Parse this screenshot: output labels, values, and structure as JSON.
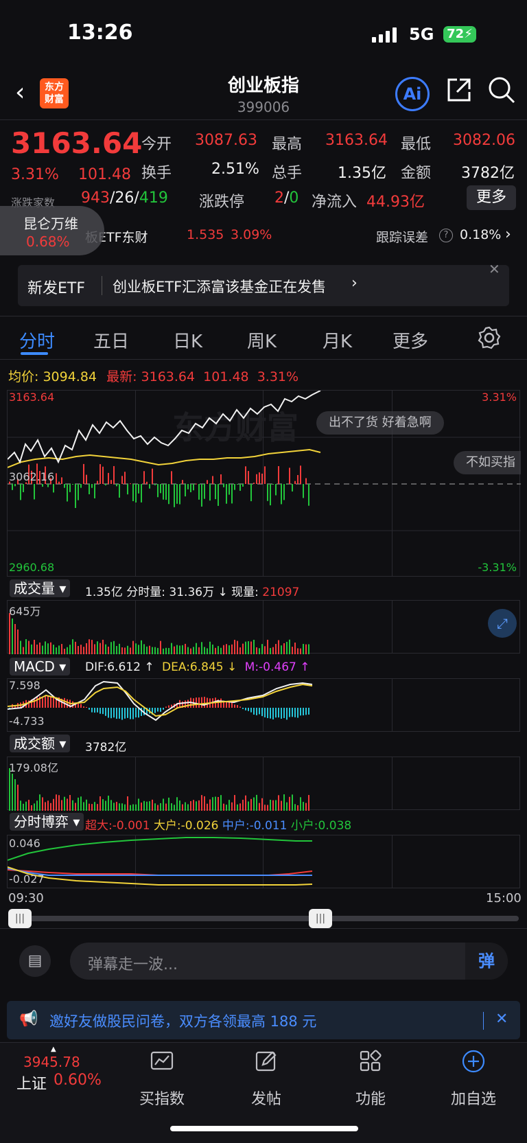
{
  "status": {
    "time": "13:26",
    "network": "5G",
    "battery": "72"
  },
  "header": {
    "logo": "东方财富",
    "title": "创业板指",
    "code": "399006",
    "ai_label": "Ai"
  },
  "quote": {
    "price": "3163.64",
    "change_pct": "3.31%",
    "change": "101.48",
    "open_label": "今开",
    "open": "3087.63",
    "high_label": "最高",
    "high": "3163.64",
    "low_label": "最低",
    "low": "3082.06",
    "turnover_label": "换手",
    "turnover": "2.51%",
    "volume_label": "总手",
    "volume": "1.35亿",
    "amount_label": "金额",
    "amount": "3782亿",
    "breadth_label": "涨跌家数",
    "up": "943",
    "flat": "26",
    "down": "419",
    "limit_label": "涨跌停",
    "limit_up": "2",
    "limit_down": "0",
    "netflow_label": "净流入",
    "netflow": "44.93亿",
    "more": "更多"
  },
  "bubble": {
    "name": "昆仑万维",
    "pct": "0.68%"
  },
  "etf": {
    "text": "板ETF东财",
    "price": "1.535",
    "pct": "3.09%",
    "track_label": "跟踪误差",
    "track_value": "0.18%"
  },
  "banner": {
    "tag": "新发ETF",
    "text": "创业板ETF汇添富该基金正在发售"
  },
  "tabs": [
    "分时",
    "五日",
    "日K",
    "周K",
    "月K",
    "更多"
  ],
  "intraday": {
    "avg_label": "均价:",
    "avg": "3094.84",
    "latest_label": "最新:",
    "latest": "3163.64",
    "chg": "101.48",
    "chg_pct": "3.31%",
    "y_top": "3163.64",
    "y_mid": "3062.16",
    "y_bottom": "2960.68",
    "pct_top": "3.31%",
    "pct_bottom": "-3.31%",
    "danmu1": "出不了货 好着急啊",
    "danmu2": "不如买指"
  },
  "volume": {
    "label": "成交量",
    "total": "1.35亿",
    "min_label": "分时量:",
    "min_val": "31.36万",
    "now_label": "现量:",
    "now_val": "21097",
    "axis_top": "645万"
  },
  "macd": {
    "label": "MACD",
    "dif": "DIF:6.612",
    "dea": "DEA:6.845",
    "m": "M:-0.467",
    "axis_top": "7.598",
    "axis_bottom": "-4.733"
  },
  "amount": {
    "label": "成交额",
    "total": "3782亿",
    "axis_top": "179.08亿"
  },
  "game": {
    "label": "分时博弈",
    "super": "超大:-0.001",
    "large": "大户:-0.026",
    "mid": "中户:-0.011",
    "small": "小户:0.038",
    "axis_top": "0.046",
    "axis_bottom": "-0.027",
    "t_start": "09:30",
    "t_end": "15:00"
  },
  "danmu": {
    "placeholder": "弹幕走一波...",
    "send": "弹"
  },
  "ad": {
    "text": "邀好友做股民问卷，双方各领最高 188 元"
  },
  "bottom_nav": {
    "index_price": "3945.78",
    "index_name": "上证",
    "index_pct": "0.60%",
    "items": [
      "买指数",
      "发帖",
      "功能",
      "加自选"
    ]
  },
  "colors": {
    "up": "#f23b3b",
    "down": "#22c53b",
    "accent": "#3d8bff",
    "avg": "#f2d33a"
  }
}
